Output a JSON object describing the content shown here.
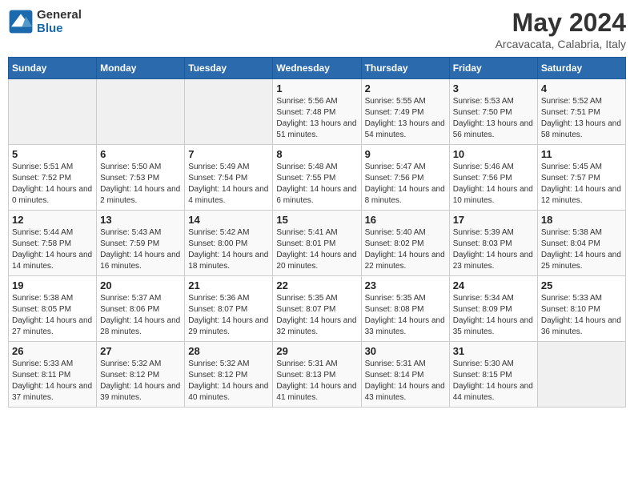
{
  "logo": {
    "line1": "General",
    "line2": "Blue"
  },
  "title": "May 2024",
  "subtitle": "Arcavacata, Calabria, Italy",
  "days_of_week": [
    "Sunday",
    "Monday",
    "Tuesday",
    "Wednesday",
    "Thursday",
    "Friday",
    "Saturday"
  ],
  "weeks": [
    [
      {
        "day": "",
        "info": ""
      },
      {
        "day": "",
        "info": ""
      },
      {
        "day": "",
        "info": ""
      },
      {
        "day": "1",
        "sunrise": "5:56 AM",
        "sunset": "7:48 PM",
        "daylight": "13 hours and 51 minutes."
      },
      {
        "day": "2",
        "sunrise": "5:55 AM",
        "sunset": "7:49 PM",
        "daylight": "13 hours and 54 minutes."
      },
      {
        "day": "3",
        "sunrise": "5:53 AM",
        "sunset": "7:50 PM",
        "daylight": "13 hours and 56 minutes."
      },
      {
        "day": "4",
        "sunrise": "5:52 AM",
        "sunset": "7:51 PM",
        "daylight": "13 hours and 58 minutes."
      }
    ],
    [
      {
        "day": "5",
        "sunrise": "5:51 AM",
        "sunset": "7:52 PM",
        "daylight": "14 hours and 0 minutes."
      },
      {
        "day": "6",
        "sunrise": "5:50 AM",
        "sunset": "7:53 PM",
        "daylight": "14 hours and 2 minutes."
      },
      {
        "day": "7",
        "sunrise": "5:49 AM",
        "sunset": "7:54 PM",
        "daylight": "14 hours and 4 minutes."
      },
      {
        "day": "8",
        "sunrise": "5:48 AM",
        "sunset": "7:55 PM",
        "daylight": "14 hours and 6 minutes."
      },
      {
        "day": "9",
        "sunrise": "5:47 AM",
        "sunset": "7:56 PM",
        "daylight": "14 hours and 8 minutes."
      },
      {
        "day": "10",
        "sunrise": "5:46 AM",
        "sunset": "7:56 PM",
        "daylight": "14 hours and 10 minutes."
      },
      {
        "day": "11",
        "sunrise": "5:45 AM",
        "sunset": "7:57 PM",
        "daylight": "14 hours and 12 minutes."
      }
    ],
    [
      {
        "day": "12",
        "sunrise": "5:44 AM",
        "sunset": "7:58 PM",
        "daylight": "14 hours and 14 minutes."
      },
      {
        "day": "13",
        "sunrise": "5:43 AM",
        "sunset": "7:59 PM",
        "daylight": "14 hours and 16 minutes."
      },
      {
        "day": "14",
        "sunrise": "5:42 AM",
        "sunset": "8:00 PM",
        "daylight": "14 hours and 18 minutes."
      },
      {
        "day": "15",
        "sunrise": "5:41 AM",
        "sunset": "8:01 PM",
        "daylight": "14 hours and 20 minutes."
      },
      {
        "day": "16",
        "sunrise": "5:40 AM",
        "sunset": "8:02 PM",
        "daylight": "14 hours and 22 minutes."
      },
      {
        "day": "17",
        "sunrise": "5:39 AM",
        "sunset": "8:03 PM",
        "daylight": "14 hours and 23 minutes."
      },
      {
        "day": "18",
        "sunrise": "5:38 AM",
        "sunset": "8:04 PM",
        "daylight": "14 hours and 25 minutes."
      }
    ],
    [
      {
        "day": "19",
        "sunrise": "5:38 AM",
        "sunset": "8:05 PM",
        "daylight": "14 hours and 27 minutes."
      },
      {
        "day": "20",
        "sunrise": "5:37 AM",
        "sunset": "8:06 PM",
        "daylight": "14 hours and 28 minutes."
      },
      {
        "day": "21",
        "sunrise": "5:36 AM",
        "sunset": "8:07 PM",
        "daylight": "14 hours and 29 minutes."
      },
      {
        "day": "22",
        "sunrise": "5:35 AM",
        "sunset": "8:07 PM",
        "daylight": "14 hours and 32 minutes."
      },
      {
        "day": "23",
        "sunrise": "5:35 AM",
        "sunset": "8:08 PM",
        "daylight": "14 hours and 33 minutes."
      },
      {
        "day": "24",
        "sunrise": "5:34 AM",
        "sunset": "8:09 PM",
        "daylight": "14 hours and 35 minutes."
      },
      {
        "day": "25",
        "sunrise": "5:33 AM",
        "sunset": "8:10 PM",
        "daylight": "14 hours and 36 minutes."
      }
    ],
    [
      {
        "day": "26",
        "sunrise": "5:33 AM",
        "sunset": "8:11 PM",
        "daylight": "14 hours and 37 minutes."
      },
      {
        "day": "27",
        "sunrise": "5:32 AM",
        "sunset": "8:12 PM",
        "daylight": "14 hours and 39 minutes."
      },
      {
        "day": "28",
        "sunrise": "5:32 AM",
        "sunset": "8:12 PM",
        "daylight": "14 hours and 40 minutes."
      },
      {
        "day": "29",
        "sunrise": "5:31 AM",
        "sunset": "8:13 PM",
        "daylight": "14 hours and 41 minutes."
      },
      {
        "day": "30",
        "sunrise": "5:31 AM",
        "sunset": "8:14 PM",
        "daylight": "14 hours and 43 minutes."
      },
      {
        "day": "31",
        "sunrise": "5:30 AM",
        "sunset": "8:15 PM",
        "daylight": "14 hours and 44 minutes."
      },
      {
        "day": "",
        "info": ""
      }
    ]
  ],
  "labels": {
    "sunrise": "Sunrise:",
    "sunset": "Sunset:",
    "daylight": "Daylight:"
  }
}
